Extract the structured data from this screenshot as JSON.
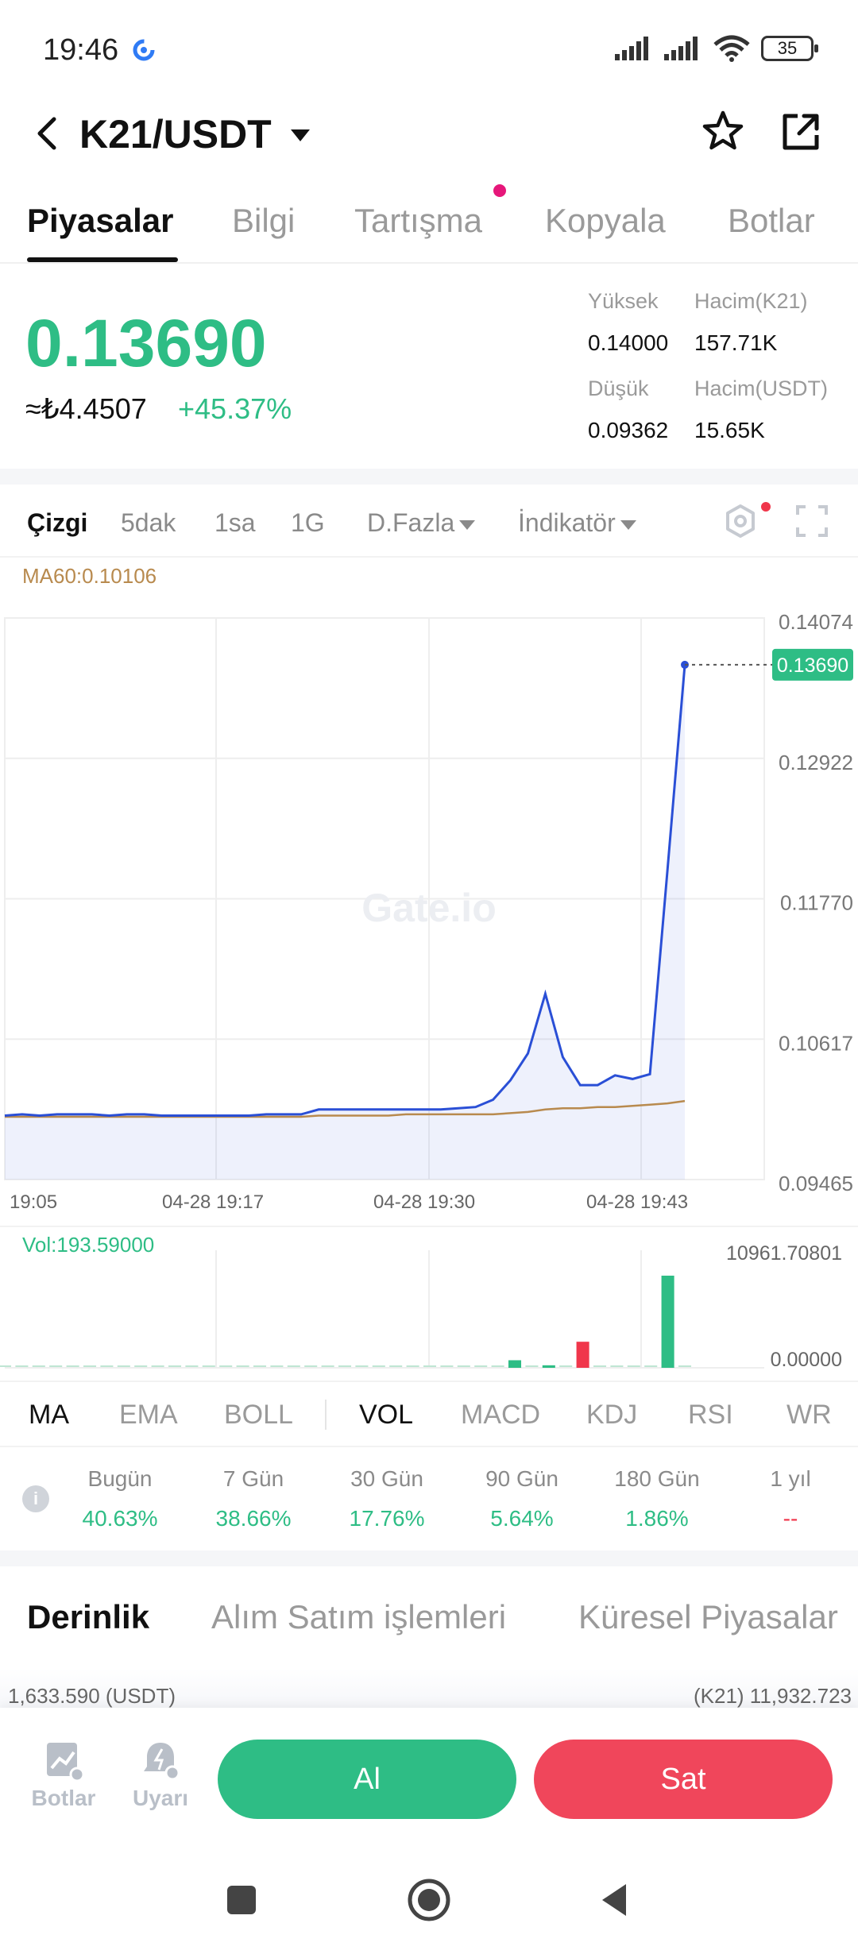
{
  "status": {
    "time": "19:46",
    "battery": "35"
  },
  "header": {
    "pair": "K21/USDT"
  },
  "tabs": [
    {
      "label": "Piyasalar",
      "active": true
    },
    {
      "label": "Bilgi"
    },
    {
      "label": "Tartışma"
    },
    {
      "label": "Kopyala"
    },
    {
      "label": "Botlar"
    }
  ],
  "ticker": {
    "last_price": "0.13690",
    "fiat_price": "≈₺4.4507",
    "change": "+45.37%",
    "high_label": "Yüksek",
    "high_value": "0.14000",
    "low_label": "Düşük",
    "low_value": "0.09362",
    "vol_base_label": "Hacim(K21)",
    "vol_base_value": "157.71K",
    "vol_quote_label": "Hacim(USDT)",
    "vol_quote_value": "15.65K"
  },
  "chart_toolbar": {
    "items": [
      "Çizgi",
      "5dak",
      "1sa",
      "1G"
    ],
    "more": "D.Fazla",
    "indicator": "İndikatör"
  },
  "ma_legend": "MA60:0.10106",
  "watermark": "Gate.io",
  "chart_data": {
    "type": "line",
    "y_axis_labels": [
      "0.14074",
      "0.12922",
      "0.11770",
      "0.10617",
      "0.09465"
    ],
    "ylim": [
      0.09465,
      0.14074
    ],
    "x_tick_labels": [
      "19:05",
      "04-28 19:17",
      "04-28 19:30",
      "04-28 19:43"
    ],
    "last_price_tag": "0.13690",
    "series": [
      {
        "values": [
          0.0999,
          0.1,
          0.0999,
          0.1,
          0.1,
          0.1,
          0.0999,
          0.1,
          0.1,
          0.0999,
          0.0999,
          0.0999,
          0.0999,
          0.0999,
          0.0999,
          0.1,
          0.1,
          0.1,
          0.1004,
          0.1004,
          0.1004,
          0.1004,
          0.1004,
          0.1004,
          0.1004,
          0.1004,
          0.1005,
          0.1006,
          0.1012,
          0.1028,
          0.105,
          0.1099,
          0.1047,
          0.1024,
          0.1024,
          0.1032,
          0.1029,
          0.1033,
          0.12,
          0.1369
        ]
      },
      {
        "name": "MA60",
        "values": [
          0.0998,
          0.0998,
          0.0998,
          0.0998,
          0.0998,
          0.0998,
          0.0998,
          0.0998,
          0.0998,
          0.0998,
          0.0998,
          0.0998,
          0.0998,
          0.0998,
          0.0998,
          0.0998,
          0.0998,
          0.0998,
          0.0999,
          0.0999,
          0.0999,
          0.0999,
          0.0999,
          0.1,
          0.1,
          0.1,
          0.1,
          0.1,
          0.1,
          0.1001,
          0.1002,
          0.1004,
          0.1005,
          0.1005,
          0.1006,
          0.1006,
          0.1007,
          0.1008,
          0.1009,
          0.1011
        ]
      }
    ]
  },
  "volume_chart": {
    "label": "Vol:193.59000",
    "max_label": "10961.70801",
    "min_label": "0.00000",
    "max_value": 10961.70801,
    "bars": [
      {
        "v": 40,
        "c": "g"
      },
      {
        "v": 40,
        "c": "g"
      },
      {
        "v": 40,
        "c": "g"
      },
      {
        "v": 0,
        "c": "g"
      },
      {
        "v": 80,
        "c": "g"
      },
      {
        "v": 80,
        "c": "g"
      },
      {
        "v": 80,
        "c": "g"
      },
      {
        "v": 0,
        "c": "g"
      },
      {
        "v": 60,
        "c": "g"
      },
      {
        "v": 60,
        "c": "g"
      },
      {
        "v": 60,
        "c": "g"
      },
      {
        "v": 60,
        "c": "g"
      },
      {
        "v": 60,
        "c": "g"
      },
      {
        "v": 0,
        "c": "g"
      },
      {
        "v": 40,
        "c": "g"
      },
      {
        "v": 40,
        "c": "g"
      },
      {
        "v": 40,
        "c": "g"
      },
      {
        "v": 40,
        "c": "g"
      },
      {
        "v": 0,
        "c": "g"
      },
      {
        "v": 60,
        "c": "g"
      },
      {
        "v": 0,
        "c": "g"
      },
      {
        "v": 0,
        "c": "g"
      },
      {
        "v": 0,
        "c": "g"
      },
      {
        "v": 0,
        "c": "g"
      },
      {
        "v": 0,
        "c": "g"
      },
      {
        "v": 0,
        "c": "g"
      },
      {
        "v": 0,
        "c": "g"
      },
      {
        "v": 0,
        "c": "g"
      },
      {
        "v": 60,
        "c": "g"
      },
      {
        "v": 80,
        "c": "g"
      },
      {
        "v": 900,
        "c": "g"
      },
      {
        "v": 80,
        "c": "g"
      },
      {
        "v": 300,
        "c": "g"
      },
      {
        "v": 120,
        "c": "r"
      },
      {
        "v": 3100,
        "c": "r"
      },
      {
        "v": 0,
        "c": "g"
      },
      {
        "v": 40,
        "c": "g"
      },
      {
        "v": 40,
        "c": "g"
      },
      {
        "v": 40,
        "c": "g"
      },
      {
        "v": 10961.7,
        "c": "g"
      },
      {
        "v": 80,
        "c": "g"
      }
    ]
  },
  "indicators": [
    {
      "label": "MA",
      "active": true
    },
    {
      "label": "EMA"
    },
    {
      "label": "BOLL"
    },
    {
      "label": "VOL",
      "active": true
    },
    {
      "label": "MACD"
    },
    {
      "label": "KDJ"
    },
    {
      "label": "RSI"
    },
    {
      "label": "WR"
    }
  ],
  "performance": [
    {
      "period": "Bugün",
      "value": "40.63%"
    },
    {
      "period": "7 Gün",
      "value": "38.66%"
    },
    {
      "period": "30 Gün",
      "value": "17.76%"
    },
    {
      "period": "90 Gün",
      "value": "5.64%"
    },
    {
      "period": "180 Gün",
      "value": "1.86%"
    },
    {
      "period": "1 yıl",
      "value": "--"
    }
  ],
  "depth_tabs": [
    "Derinlik",
    "Alım Satım işlemleri",
    "Küresel Piyasalar"
  ],
  "depth_totals": {
    "left": "1,633.590 (USDT)",
    "right": "(K21) 11,932.723"
  },
  "bottom": {
    "bots_label": "Botlar",
    "alerts_label": "Uyarı",
    "buy": "Al",
    "sell": "Sat"
  },
  "colors": {
    "up": "#2ebd85",
    "down": "#f0364b",
    "line": "#2a4fd6",
    "ma": "#b88a4e"
  }
}
